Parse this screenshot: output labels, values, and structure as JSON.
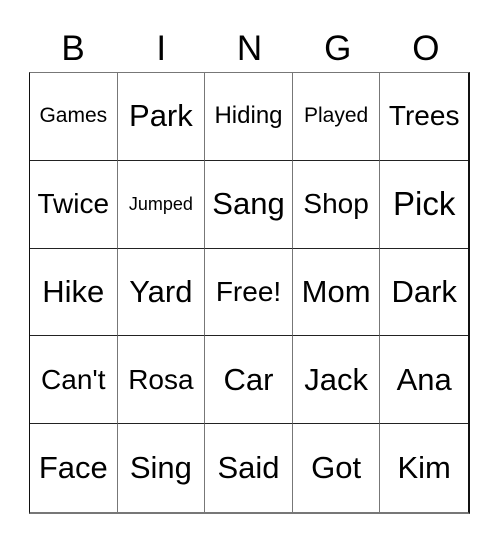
{
  "card": {
    "header": [
      "B",
      "I",
      "N",
      "G",
      "O"
    ],
    "rows": [
      [
        "Games",
        "Park",
        "Hiding",
        "Played",
        "Trees"
      ],
      [
        "Twice",
        "Jumped",
        "Sang",
        "Shop",
        "Pick"
      ],
      [
        "Hike",
        "Yard",
        "Free!",
        "Mom",
        "Dark"
      ],
      [
        "Can't",
        "Rosa",
        "Car",
        "Jack",
        "Ana"
      ],
      [
        "Face",
        "Sing",
        "Said",
        "Got",
        "Kim"
      ]
    ]
  },
  "colors": {
    "text": "#000000",
    "grid_line": "#777777",
    "background": "#ffffff"
  }
}
